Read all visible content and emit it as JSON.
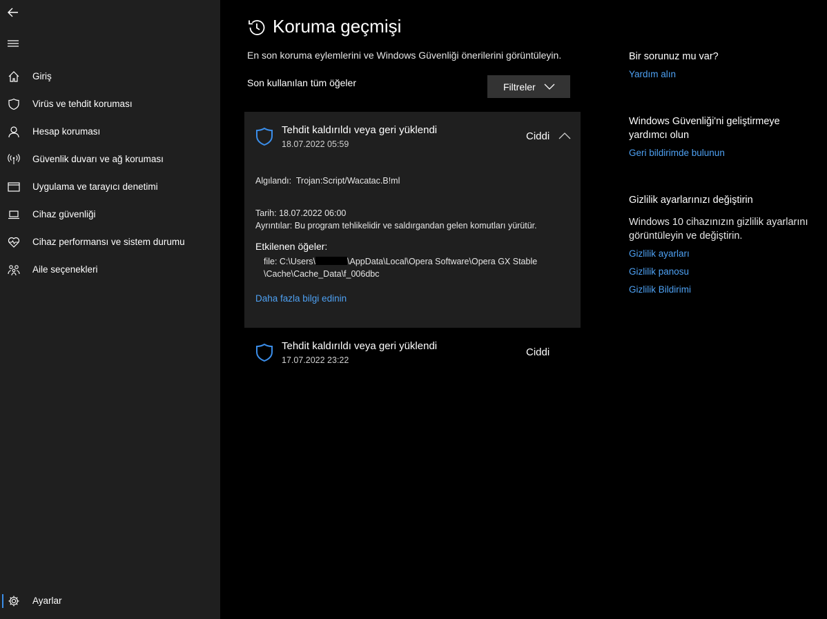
{
  "sidebar": {
    "items": [
      {
        "label": "Giriş",
        "icon": "home-icon"
      },
      {
        "label": "Virüs ve tehdit koruması",
        "icon": "shield-icon"
      },
      {
        "label": "Hesap koruması",
        "icon": "person-icon"
      },
      {
        "label": "Güvenlik duvarı ve ağ koruması",
        "icon": "wifi-antenna-icon"
      },
      {
        "label": "Uygulama ve tarayıcı denetimi",
        "icon": "browser-window-icon"
      },
      {
        "label": "Cihaz güvenliği",
        "icon": "laptop-icon"
      },
      {
        "label": "Cihaz performansı ve sistem durumu",
        "icon": "heart-pulse-icon"
      },
      {
        "label": "Aile seçenekleri",
        "icon": "family-icon"
      }
    ],
    "settings_label": "Ayarlar"
  },
  "main": {
    "title": "Koruma geçmişi",
    "subtitle": "En son koruma eylemlerini ve Windows Güvenliği önerilerini görüntüleyin.",
    "list_label": "Son kullanılan tüm öğeler",
    "filter_label": "Filtreler",
    "events": [
      {
        "title": "Tehdit kaldırıldı veya geri yüklendi",
        "date": "18.07.2022 05:59",
        "severity": "Ciddi",
        "expanded": true,
        "detected_label": "Algılandı:",
        "detected_value": "Trojan:Script/Wacatac.B!ml",
        "date_label": "Tarih:",
        "date_value": "18.07.2022 06:00",
        "details_label": "Ayrıntılar:",
        "details_value": "Bu program tehlikelidir ve saldırgandan gelen komutları yürütür.",
        "affected_heading": "Etkilenen öğeler:",
        "file_line1_prefix": "file: C:\\Users\\",
        "file_line1_suffix": "\\AppData\\Local\\Opera Software\\Opera GX Stable",
        "file_line2": "\\Cache\\Cache_Data\\f_006dbc",
        "more_info_link": "Daha fazla bilgi edinin"
      },
      {
        "title": "Tehdit kaldırıldı veya geri yüklendi",
        "date": "17.07.2022 23:22",
        "severity": "Ciddi",
        "expanded": false
      }
    ]
  },
  "right_panel": {
    "help_heading": "Bir sorunuz mu var?",
    "help_link": "Yardım alın",
    "improve_heading": "Windows Güvenliği'ni geliştirmeye yardımcı olun",
    "improve_link": "Geri bildirimde bulunun",
    "privacy_heading": "Gizlilik ayarlarınızı değiştirin",
    "privacy_text": "Windows 10 cihazınızın gizlilik ayarlarını görüntüleyin ve değiştirin.",
    "privacy_links": [
      "Gizlilik ayarları",
      "Gizlilik panosu",
      "Gizlilik Bildirimi"
    ]
  },
  "colors": {
    "sidebar_bg": "#1f1f1f",
    "main_bg": "#000000",
    "accent": "#3b8eea",
    "link": "#4ea1f3",
    "card_bg": "#1f1f1f",
    "button_bg": "#333333"
  }
}
